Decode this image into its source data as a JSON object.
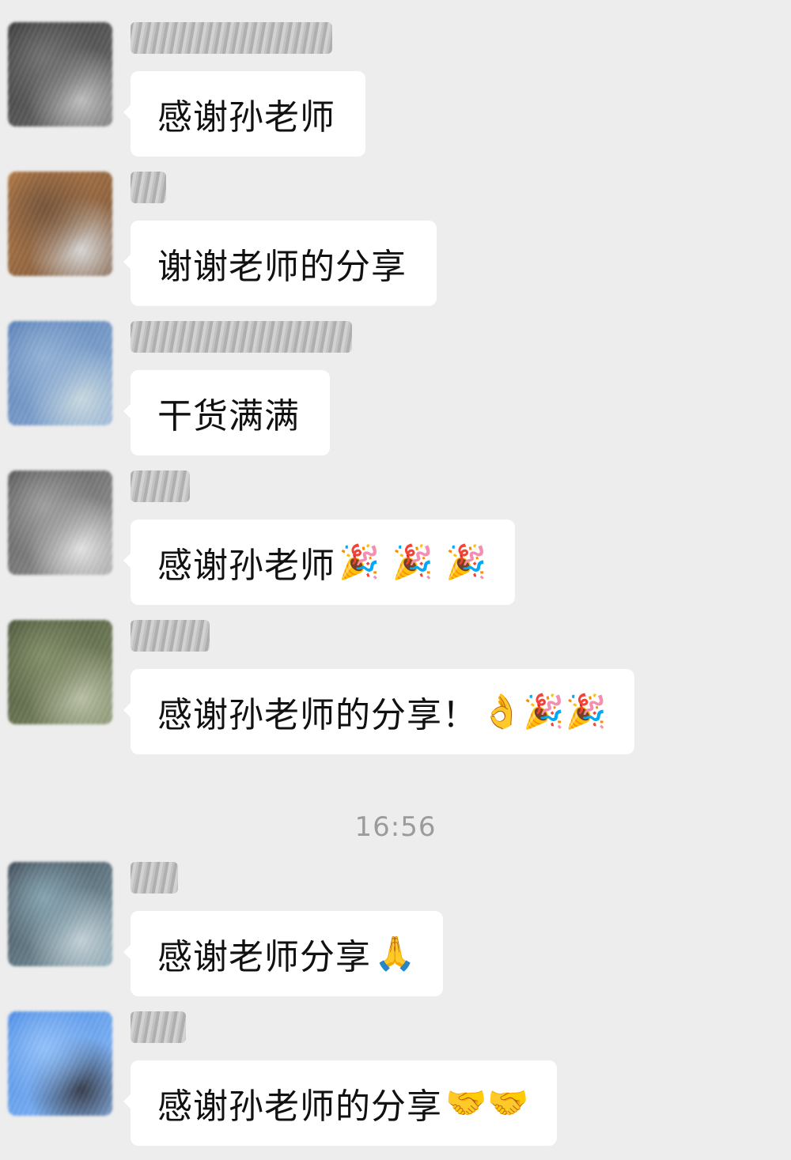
{
  "messages": [
    {
      "text": "感谢孙老师",
      "emoji": "",
      "avatar_colors": [
        "#2b2b2b",
        "#6a6a6a",
        "#bdbdbd"
      ]
    },
    {
      "text": "谢谢老师的分享",
      "emoji": "",
      "avatar_colors": [
        "#b8763c",
        "#6e4a2d",
        "#d9d9d9"
      ]
    },
    {
      "text": "干货满满",
      "emoji": "",
      "avatar_colors": [
        "#4b77b5",
        "#8fb1d9",
        "#c9dbe3"
      ]
    },
    {
      "text": "感谢孙老师",
      "emoji": "🎉 🎉 🎉",
      "avatar_colors": [
        "#4a4a4a",
        "#9c9c9c",
        "#e6e6e6"
      ]
    },
    {
      "text": "感谢孙老师的分享！",
      "emoji": "👌🎉🎉",
      "avatar_colors": [
        "#3e4a2e",
        "#7d8a5f",
        "#b8bfa3"
      ]
    },
    {
      "text": "感谢老师分享",
      "emoji": "🙏",
      "avatar_colors": [
        "#2f3a45",
        "#7fa2b0",
        "#c3d2d9"
      ]
    },
    {
      "text": "感谢孙老师的分享",
      "emoji": "🤝🤝",
      "avatar_colors": [
        "#3d86e8",
        "#8ec0ff",
        "#2a3140"
      ]
    }
  ],
  "timestamp": "16:56"
}
